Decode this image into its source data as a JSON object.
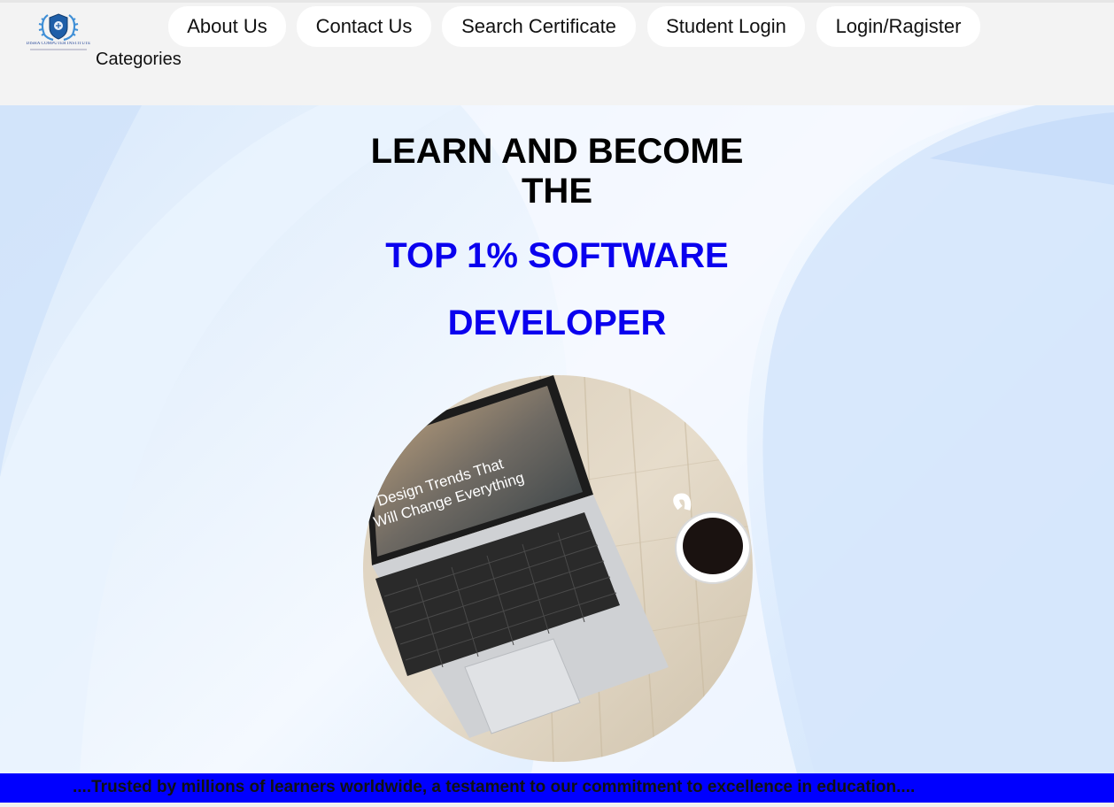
{
  "brand": {
    "logo_text": "DISHA COMPUTER INSTITUTE"
  },
  "nav": {
    "items": [
      {
        "label": "About Us"
      },
      {
        "label": "Contact Us"
      },
      {
        "label": "Search Certificate"
      },
      {
        "label": "Student Login"
      },
      {
        "label": "Login/Ragister"
      }
    ],
    "categories_label": "Categories"
  },
  "hero": {
    "headline_line1": "LEARN AND BECOME",
    "headline_line2": "THE",
    "highlight_line1": "TOP 1% SOFTWARE",
    "highlight_line2": "DEVELOPER",
    "image_caption_line1": "Design Trends That",
    "image_caption_line2": "Will Change Everything"
  },
  "ticker": {
    "text": "....Trusted by millions of learners worldwide, a testament to our commitment to excellence in education...."
  },
  "colors": {
    "accent_blue": "#0a00ee",
    "ticker_bg": "#0000ff",
    "header_bg": "#f3f3f3"
  }
}
